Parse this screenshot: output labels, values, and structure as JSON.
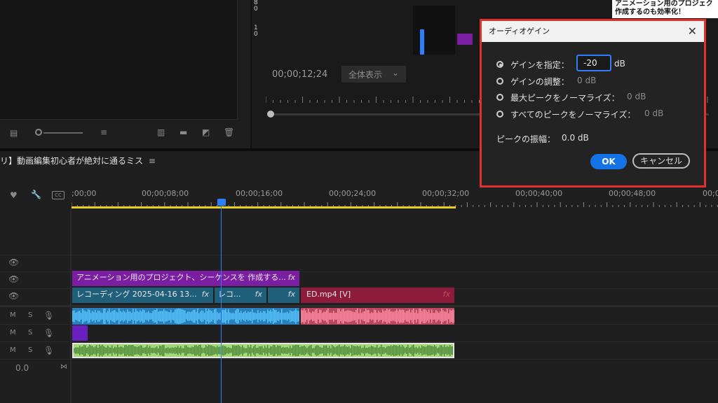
{
  "program_monitor": {
    "timecode": "00;00;12;24",
    "zoom_select": "全体表示",
    "thumb_digits": "8\n0\n\n\n1\n0"
  },
  "overlay_text": {
    "line1": "アニメーション用のプロジェク",
    "line2": "作成するのも効率化！"
  },
  "dialog": {
    "title": "オーディオゲイン",
    "options": [
      {
        "label": "ゲインを指定：",
        "value": "-20",
        "unit": "dB",
        "selected": true
      },
      {
        "label": "ゲインの調整：",
        "value": "0 dB",
        "selected": false
      },
      {
        "label": "最大ピークをノーマライズ：",
        "value": "0 dB",
        "selected": false
      },
      {
        "label": "すべてのピークをノーマライズ：",
        "value": "0 dB",
        "selected": false
      }
    ],
    "peak_label": "ピークの振幅：",
    "peak_value": "0.0 dB",
    "ok_label": "OK",
    "cancel_label": "キャンセル"
  },
  "timeline": {
    "sequence_name": "リ】動画編集初心者が絶対に通るミス",
    "ruler": [
      ";00;00",
      "00;00;08;00",
      "00;00;16;00",
      "00;00;24;00",
      "00;00;32;00",
      "00;00;40;00",
      "00;00;48;00",
      "00;0"
    ],
    "track_labels": {
      "m": "M",
      "s": "S"
    },
    "volume_readout": "0.0",
    "clips": {
      "purple_title": "アニメーション用のプロジェクト、シーケンスを 作成する...",
      "rec1": "レコーディング 2025-04-16 13...",
      "rec2": "レコ...",
      "ed": "ED.mp4 [V]",
      "fx": "fx"
    }
  },
  "colors": {
    "accent_blue": "#2d7ff9",
    "dialog_border": "#e0322b",
    "clip_purple": "#7b1fa2",
    "clip_teal": "#1f5f7a",
    "clip_red": "#8e1a3c",
    "audio_blue": "#3fa8e6",
    "audio_pink": "#e0607d",
    "audio_green": "#a6d67a"
  }
}
